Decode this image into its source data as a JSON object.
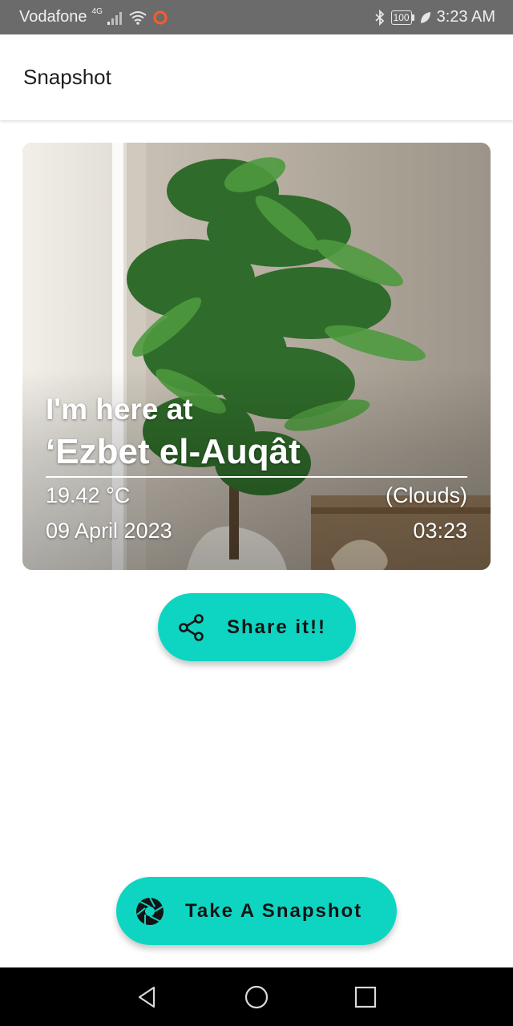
{
  "status_bar": {
    "carrier": "Vodafone",
    "network_type": "4G",
    "battery": "100",
    "time": "3:23 AM",
    "icons": [
      "signal-icon",
      "wifi-icon",
      "circle-notification-icon",
      "bluetooth-icon",
      "battery-icon",
      "leaf-icon"
    ]
  },
  "app_bar": {
    "title": "Snapshot"
  },
  "card": {
    "headline": "I'm here at",
    "location": "‘Ezbet el-Auqât",
    "temperature": "19.42 °C",
    "condition": "(Clouds)",
    "date": "09 April 2023",
    "time": "03:23"
  },
  "buttons": {
    "share_label": "Share it!!",
    "snapshot_label": "Take A Snapshot"
  },
  "nav_bar": {
    "icons": [
      "back-icon",
      "home-icon",
      "recents-icon"
    ]
  },
  "colors": {
    "accent": "#0ed5c2",
    "status_bar": "#6b6b6b",
    "nav_bar": "#000000"
  }
}
